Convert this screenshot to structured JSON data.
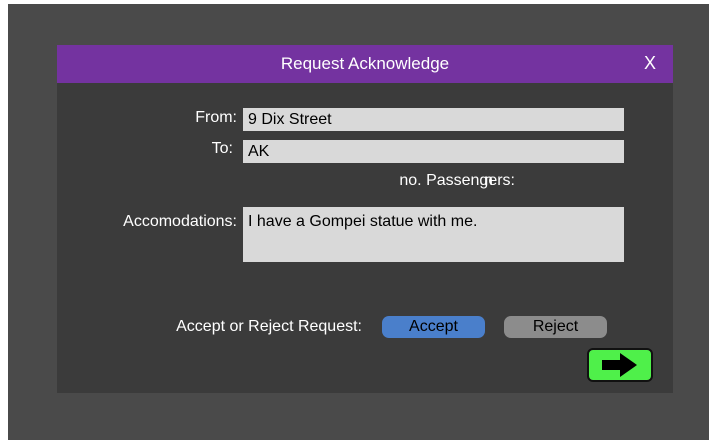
{
  "dialog": {
    "title": "Request Acknowledge",
    "close_label": "X"
  },
  "form": {
    "from_label": "From:",
    "from_value": "9 Dix Street",
    "to_label": "To:",
    "to_value": "AK",
    "passengers_label": "no. Passengers:",
    "passengers_value": "n",
    "accommodations_label": "Accomodations:",
    "accommodations_value": "I have a Gompei statue with me."
  },
  "actions": {
    "prompt_label": "Accept or Reject Request:",
    "accept_label": "Accept",
    "reject_label": "Reject",
    "next_icon": "right-arrow-icon"
  },
  "colors": {
    "title_bar": "#7433a0",
    "accept_button": "#4a7fcb",
    "reject_button": "#8c8c8c",
    "next_button": "#4ff04a"
  }
}
